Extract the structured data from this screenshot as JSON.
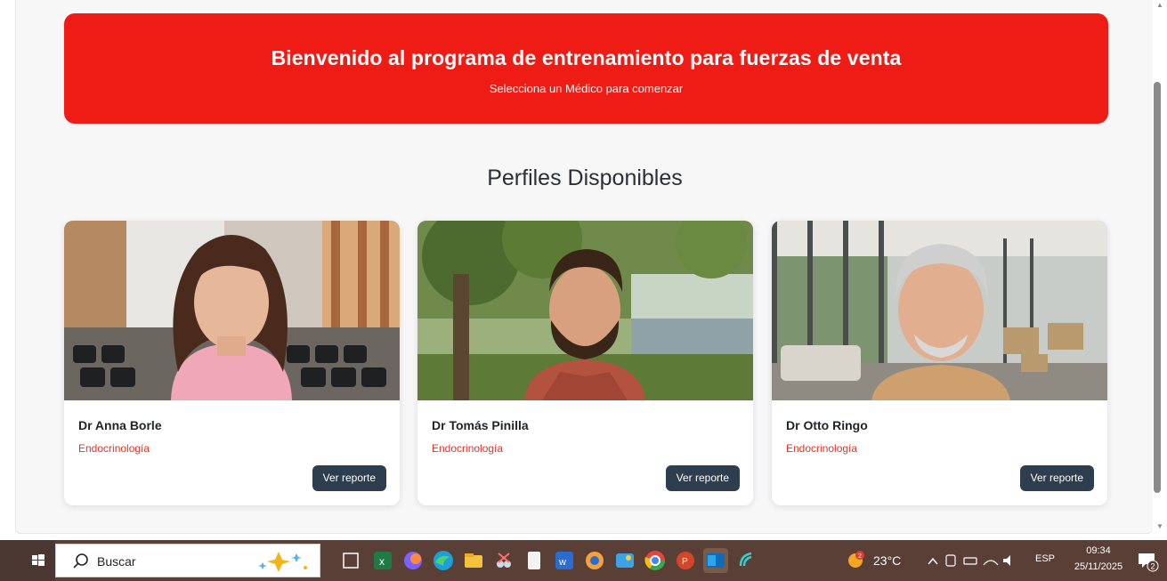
{
  "hero": {
    "title": "Bienvenido al programa de entrenamiento para fuerzas de venta",
    "subtitle": "Selecciona un Médico para comenzar"
  },
  "section": {
    "title": "Perfiles Disponibles"
  },
  "profiles": [
    {
      "name": "Dr Anna Borle",
      "specialty": "Endocrinología",
      "button": "Ver reporte"
    },
    {
      "name": "Dr Tomás Pinilla",
      "specialty": "Endocrinología",
      "button": "Ver reporte"
    },
    {
      "name": "Dr Otto Ringo",
      "specialty": "Endocrinología",
      "button": "Ver reporte"
    }
  ],
  "taskbar": {
    "search_label": "Buscar",
    "temperature": "23°C",
    "language": "ESP",
    "time": "09:34",
    "date": "25/11/2025",
    "notification_count": "2"
  },
  "colors": {
    "accent": "#ee1c15",
    "button": "#2f3e4e",
    "specialty": "#e5332a"
  }
}
